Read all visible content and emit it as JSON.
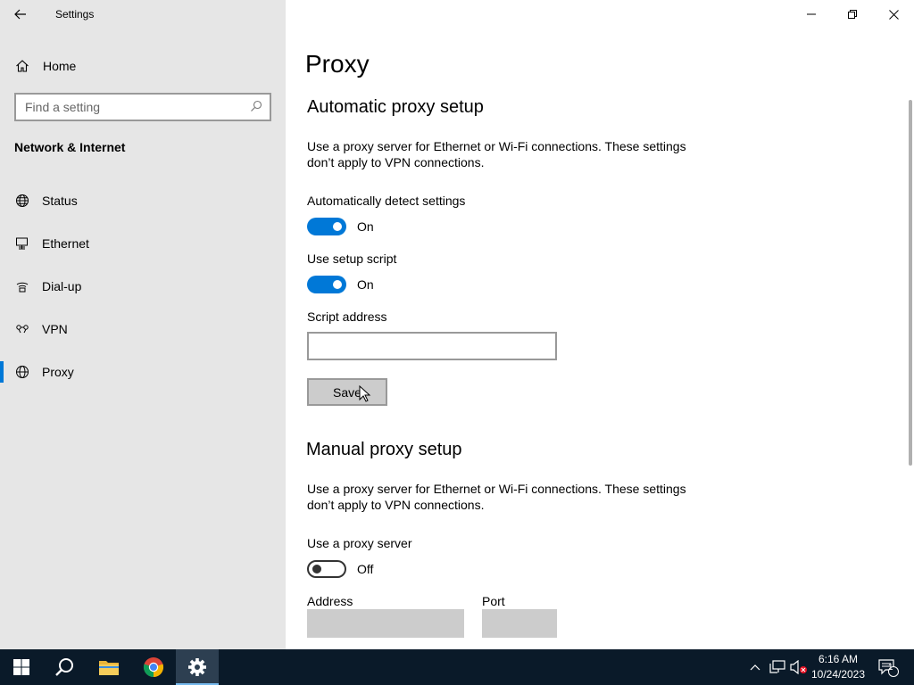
{
  "window": {
    "title": "Settings"
  },
  "sidebar": {
    "home_label": "Home",
    "search_placeholder": "Find a setting",
    "section_title": "Network & Internet",
    "items": [
      {
        "label": "Status",
        "icon": "globe-network-icon"
      },
      {
        "label": "Ethernet",
        "icon": "ethernet-icon"
      },
      {
        "label": "Dial-up",
        "icon": "dialup-icon"
      },
      {
        "label": "VPN",
        "icon": "vpn-icon"
      },
      {
        "label": "Proxy",
        "icon": "globe-icon",
        "selected": true
      }
    ]
  },
  "main": {
    "page_title": "Proxy",
    "automatic": {
      "heading": "Automatic proxy setup",
      "description": "Use a proxy server for Ethernet or Wi-Fi connections. These settings don’t apply to VPN connections.",
      "detect_label": "Automatically detect settings",
      "detect_state": "On",
      "script_label": "Use setup script",
      "script_state": "On",
      "address_label": "Script address",
      "address_value": "",
      "save_label": "Save"
    },
    "manual": {
      "heading": "Manual proxy setup",
      "description": "Use a proxy server for Ethernet or Wi-Fi connections. These settings don’t apply to VPN connections.",
      "use_proxy_label": "Use a proxy server",
      "use_proxy_state": "Off",
      "address_label": "Address",
      "port_label": "Port"
    }
  },
  "taskbar": {
    "time": "6:16 AM",
    "date": "10/24/2023",
    "notification_count": "1"
  },
  "colors": {
    "accent": "#0078d7",
    "taskbar": "#0a1a29",
    "sidebar": "#e6e6e6"
  }
}
